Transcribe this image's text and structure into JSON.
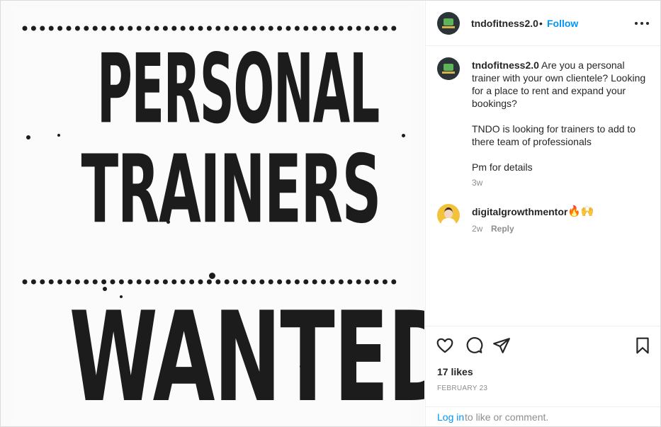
{
  "post_image": {
    "line1": "PERSONAL",
    "line2": "TRAINERS",
    "line3": "WANTED!"
  },
  "header": {
    "username": "tndofitness2.0",
    "separator": "•",
    "follow_label": "Follow",
    "more_icon": "more-horizontal-icon"
  },
  "caption": {
    "username": "tndofitness2.0",
    "paragraph1": "Are you a personal trainer with your own clientele? Looking for a place to rent and expand your bookings?",
    "paragraph2": "TNDO is looking for trainers to add to there team of professionals",
    "paragraph3": "Pm for details",
    "time": "3w"
  },
  "comments": [
    {
      "username": "digitalgrowthmentor",
      "text": "🔥🙌",
      "time": "2w",
      "reply_label": "Reply"
    }
  ],
  "actions": {
    "like_icon": "heart-icon",
    "comment_icon": "comment-bubble-icon",
    "share_icon": "paper-plane-icon",
    "save_icon": "bookmark-icon",
    "likes_text": "17 likes",
    "date": "FEBRUARY 23"
  },
  "login": {
    "link_text": "Log in",
    "rest_text": "to like or comment."
  },
  "colors": {
    "link_blue": "#0095f6",
    "text_primary": "#262626",
    "text_secondary": "#8e8e8e",
    "border": "#dbdbdb"
  }
}
